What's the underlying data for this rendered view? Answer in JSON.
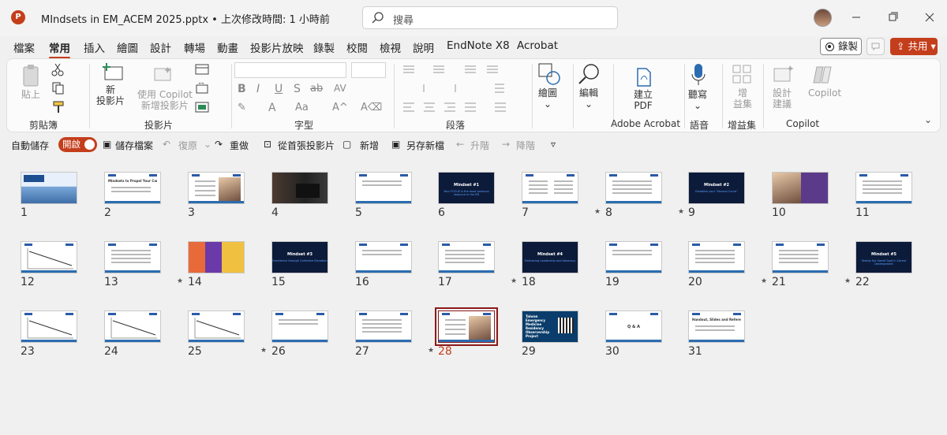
{
  "window": {
    "title": "MIndsets in EM_ACEM 2025.pptx • 上次修改時間: 1 小時前",
    "search_placeholder": "搜尋"
  },
  "menu": {
    "items": [
      "檔案",
      "常用",
      "插入",
      "繪圖",
      "設計",
      "轉場",
      "動畫",
      "投影片放映",
      "錄製",
      "校閱",
      "檢視",
      "說明",
      "EndNote X8",
      "Acrobat"
    ],
    "active": "常用",
    "record_label": "錄製",
    "share_label": "共用"
  },
  "ribbon": {
    "clipboard": {
      "label": "剪貼簿",
      "paste": "貼上"
    },
    "slides": {
      "label": "投影片",
      "new_slide": "新\n投影片",
      "copilot_new": "使用 Copilot\n新增投影片"
    },
    "font": {
      "label": "字型"
    },
    "paragraph": {
      "label": "段落"
    },
    "drawing": {
      "label": "繪圖"
    },
    "editing": {
      "label": "編輯"
    },
    "acrobat": {
      "label": "Adobe Acrobat",
      "create_pdf": "建立\nPDF"
    },
    "voice": {
      "label": "語音",
      "dictate": "聽寫"
    },
    "addins": {
      "label": "增益集",
      "addins_btn": "增\n益集"
    },
    "copilot": {
      "label": "Copilot",
      "design": "設計\n建議",
      "copilot_btn": "Copilot"
    }
  },
  "quick_access": {
    "autosave_label": "自動儲存",
    "autosave_state": "開啟",
    "save_file": "儲存檔案",
    "undo": "復原",
    "redo": "重做",
    "from_start": "從首張投影片",
    "new": "新增",
    "save_as": "另存新檔",
    "promote": "升階",
    "demote": "降階"
  },
  "slides": [
    {
      "n": "1",
      "star": false,
      "kind": "cover"
    },
    {
      "n": "2",
      "star": false,
      "kind": "title",
      "title": "Mindsets to Propel Your Career in Emergency Medicine"
    },
    {
      "n": "3",
      "star": false,
      "kind": "bio"
    },
    {
      "n": "4",
      "star": false,
      "kind": "photo-dark"
    },
    {
      "n": "5",
      "star": false,
      "kind": "text"
    },
    {
      "n": "6",
      "star": false,
      "kind": "dark",
      "title": "Mindset #1",
      "sub": "Your FOCUS is the most precious resource in the ED"
    },
    {
      "n": "7",
      "star": true,
      "kind": "twocol"
    },
    {
      "n": "8",
      "star": true,
      "kind": "list"
    },
    {
      "n": "9",
      "star": false,
      "kind": "dark",
      "title": "Mindset #2",
      "sub": "Establish your \"Second Curve\""
    },
    {
      "n": "10",
      "star": false,
      "kind": "book"
    },
    {
      "n": "11",
      "star": false,
      "kind": "list"
    },
    {
      "n": "12",
      "star": false,
      "kind": "chart"
    },
    {
      "n": "13",
      "star": true,
      "kind": "list"
    },
    {
      "n": "14",
      "star": false,
      "kind": "collage"
    },
    {
      "n": "15",
      "star": false,
      "kind": "dark",
      "title": "Mindset #3",
      "sub": "Excellence through Collective Elevation"
    },
    {
      "n": "16",
      "star": false,
      "kind": "text"
    },
    {
      "n": "17",
      "star": true,
      "kind": "list"
    },
    {
      "n": "18",
      "star": false,
      "kind": "dark",
      "title": "Mindset #4",
      "sub": "Embracing Leadership and Advocacy"
    },
    {
      "n": "19",
      "star": false,
      "kind": "text"
    },
    {
      "n": "20",
      "star": true,
      "kind": "list"
    },
    {
      "n": "21",
      "star": true,
      "kind": "list"
    },
    {
      "n": "22",
      "star": false,
      "kind": "dark",
      "title": "Mindset #5",
      "sub": "Seeing the Sweet Spot in Career Development"
    },
    {
      "n": "23",
      "star": false,
      "kind": "chart"
    },
    {
      "n": "24",
      "star": false,
      "kind": "chart"
    },
    {
      "n": "25",
      "star": true,
      "kind": "chart"
    },
    {
      "n": "26",
      "star": false,
      "kind": "text"
    },
    {
      "n": "27",
      "star": true,
      "kind": "list"
    },
    {
      "n": "28",
      "star": false,
      "kind": "bio",
      "selected": true
    },
    {
      "n": "29",
      "star": false,
      "kind": "poster",
      "title": "Taiwan Emergency Medicine Residency Observership Project"
    },
    {
      "n": "30",
      "star": false,
      "kind": "qa",
      "title": "Q & A"
    },
    {
      "n": "31",
      "star": false,
      "kind": "text",
      "title": "Handout, Slides and References"
    }
  ],
  "colors": {
    "accent": "#c43e1c",
    "selected_slide": "#8b1a1a",
    "dark_slide": "#0d1b3a"
  }
}
